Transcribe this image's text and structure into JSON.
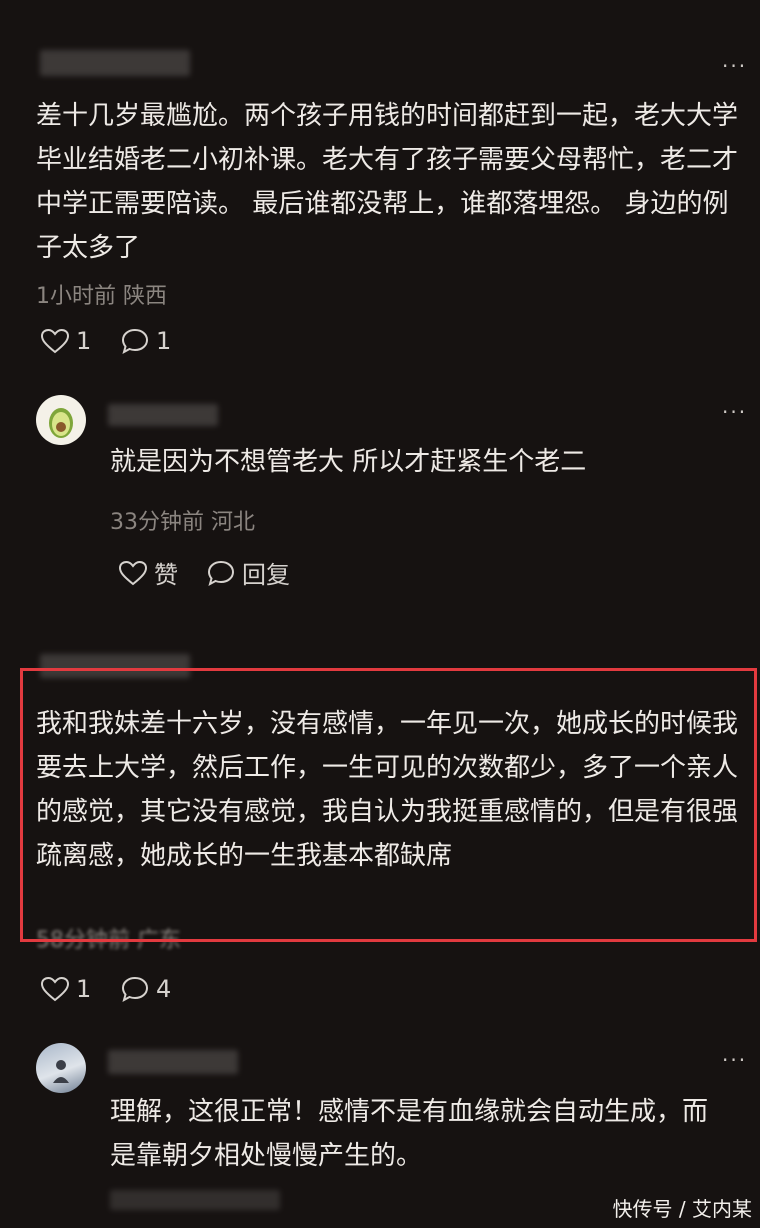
{
  "comments": [
    {
      "text": "差十几岁最尴尬。两个孩子用钱的时间都赶到一起，老大大学毕业结婚老二小初补课。老大有了孩子需要父母帮忙，老二才中学正需要陪读。 最后谁都没帮上，谁都落埋怨。 身边的例子太多了",
      "meta": "1小时前 陕西",
      "likes": "1",
      "replies": "1"
    },
    {
      "text": "就是因为不想管老大 所以才赶紧生个老二",
      "meta": "33分钟前 河北",
      "like_label": "赞",
      "reply_label": "回复"
    },
    {
      "text": "我和我妹差十六岁，没有感情，一年见一次，她成长的时候我要去上大学，然后工作，一生可见的次数都少，多了一个亲人的感觉，其它没有感觉，我自认为我挺重感情的，但是有很强疏离感，她成长的一生我基本都缺席",
      "meta": "58分钟前 广东",
      "likes": "1",
      "replies": "4"
    },
    {
      "text": "理解，这很正常！感情不是有血缘就会自动生成，而是靠朝夕相处慢慢产生的。"
    }
  ],
  "watermark": "快传号 / 艾内某",
  "colors": {
    "highlight": "#e23a3f",
    "background": "#161211"
  }
}
